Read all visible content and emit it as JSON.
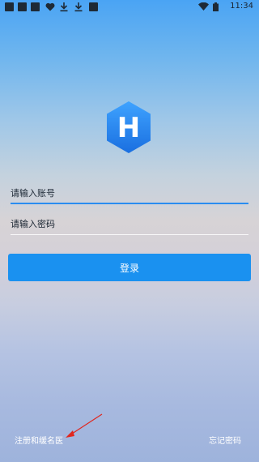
{
  "status_bar": {
    "time": "11:34",
    "icons": [
      "app-notification-icon",
      "app-notification-icon",
      "app-notification-icon",
      "heart-icon",
      "download-icon",
      "download-icon",
      "app-notification-icon",
      "wifi-icon",
      "battery-icon"
    ]
  },
  "logo": {
    "letter": "H",
    "colors": {
      "top": "#3fa3ff",
      "bottom": "#1a6fe0"
    }
  },
  "form": {
    "account_placeholder": "请输入账号",
    "password_placeholder": "请输入密码"
  },
  "login_button_label": "登录",
  "footer": {
    "register_label": "注册和缓名医",
    "forgot_label": "忘记密码"
  },
  "colors": {
    "accent": "#1a91f0",
    "annotation_arrow": "#e0271f"
  }
}
